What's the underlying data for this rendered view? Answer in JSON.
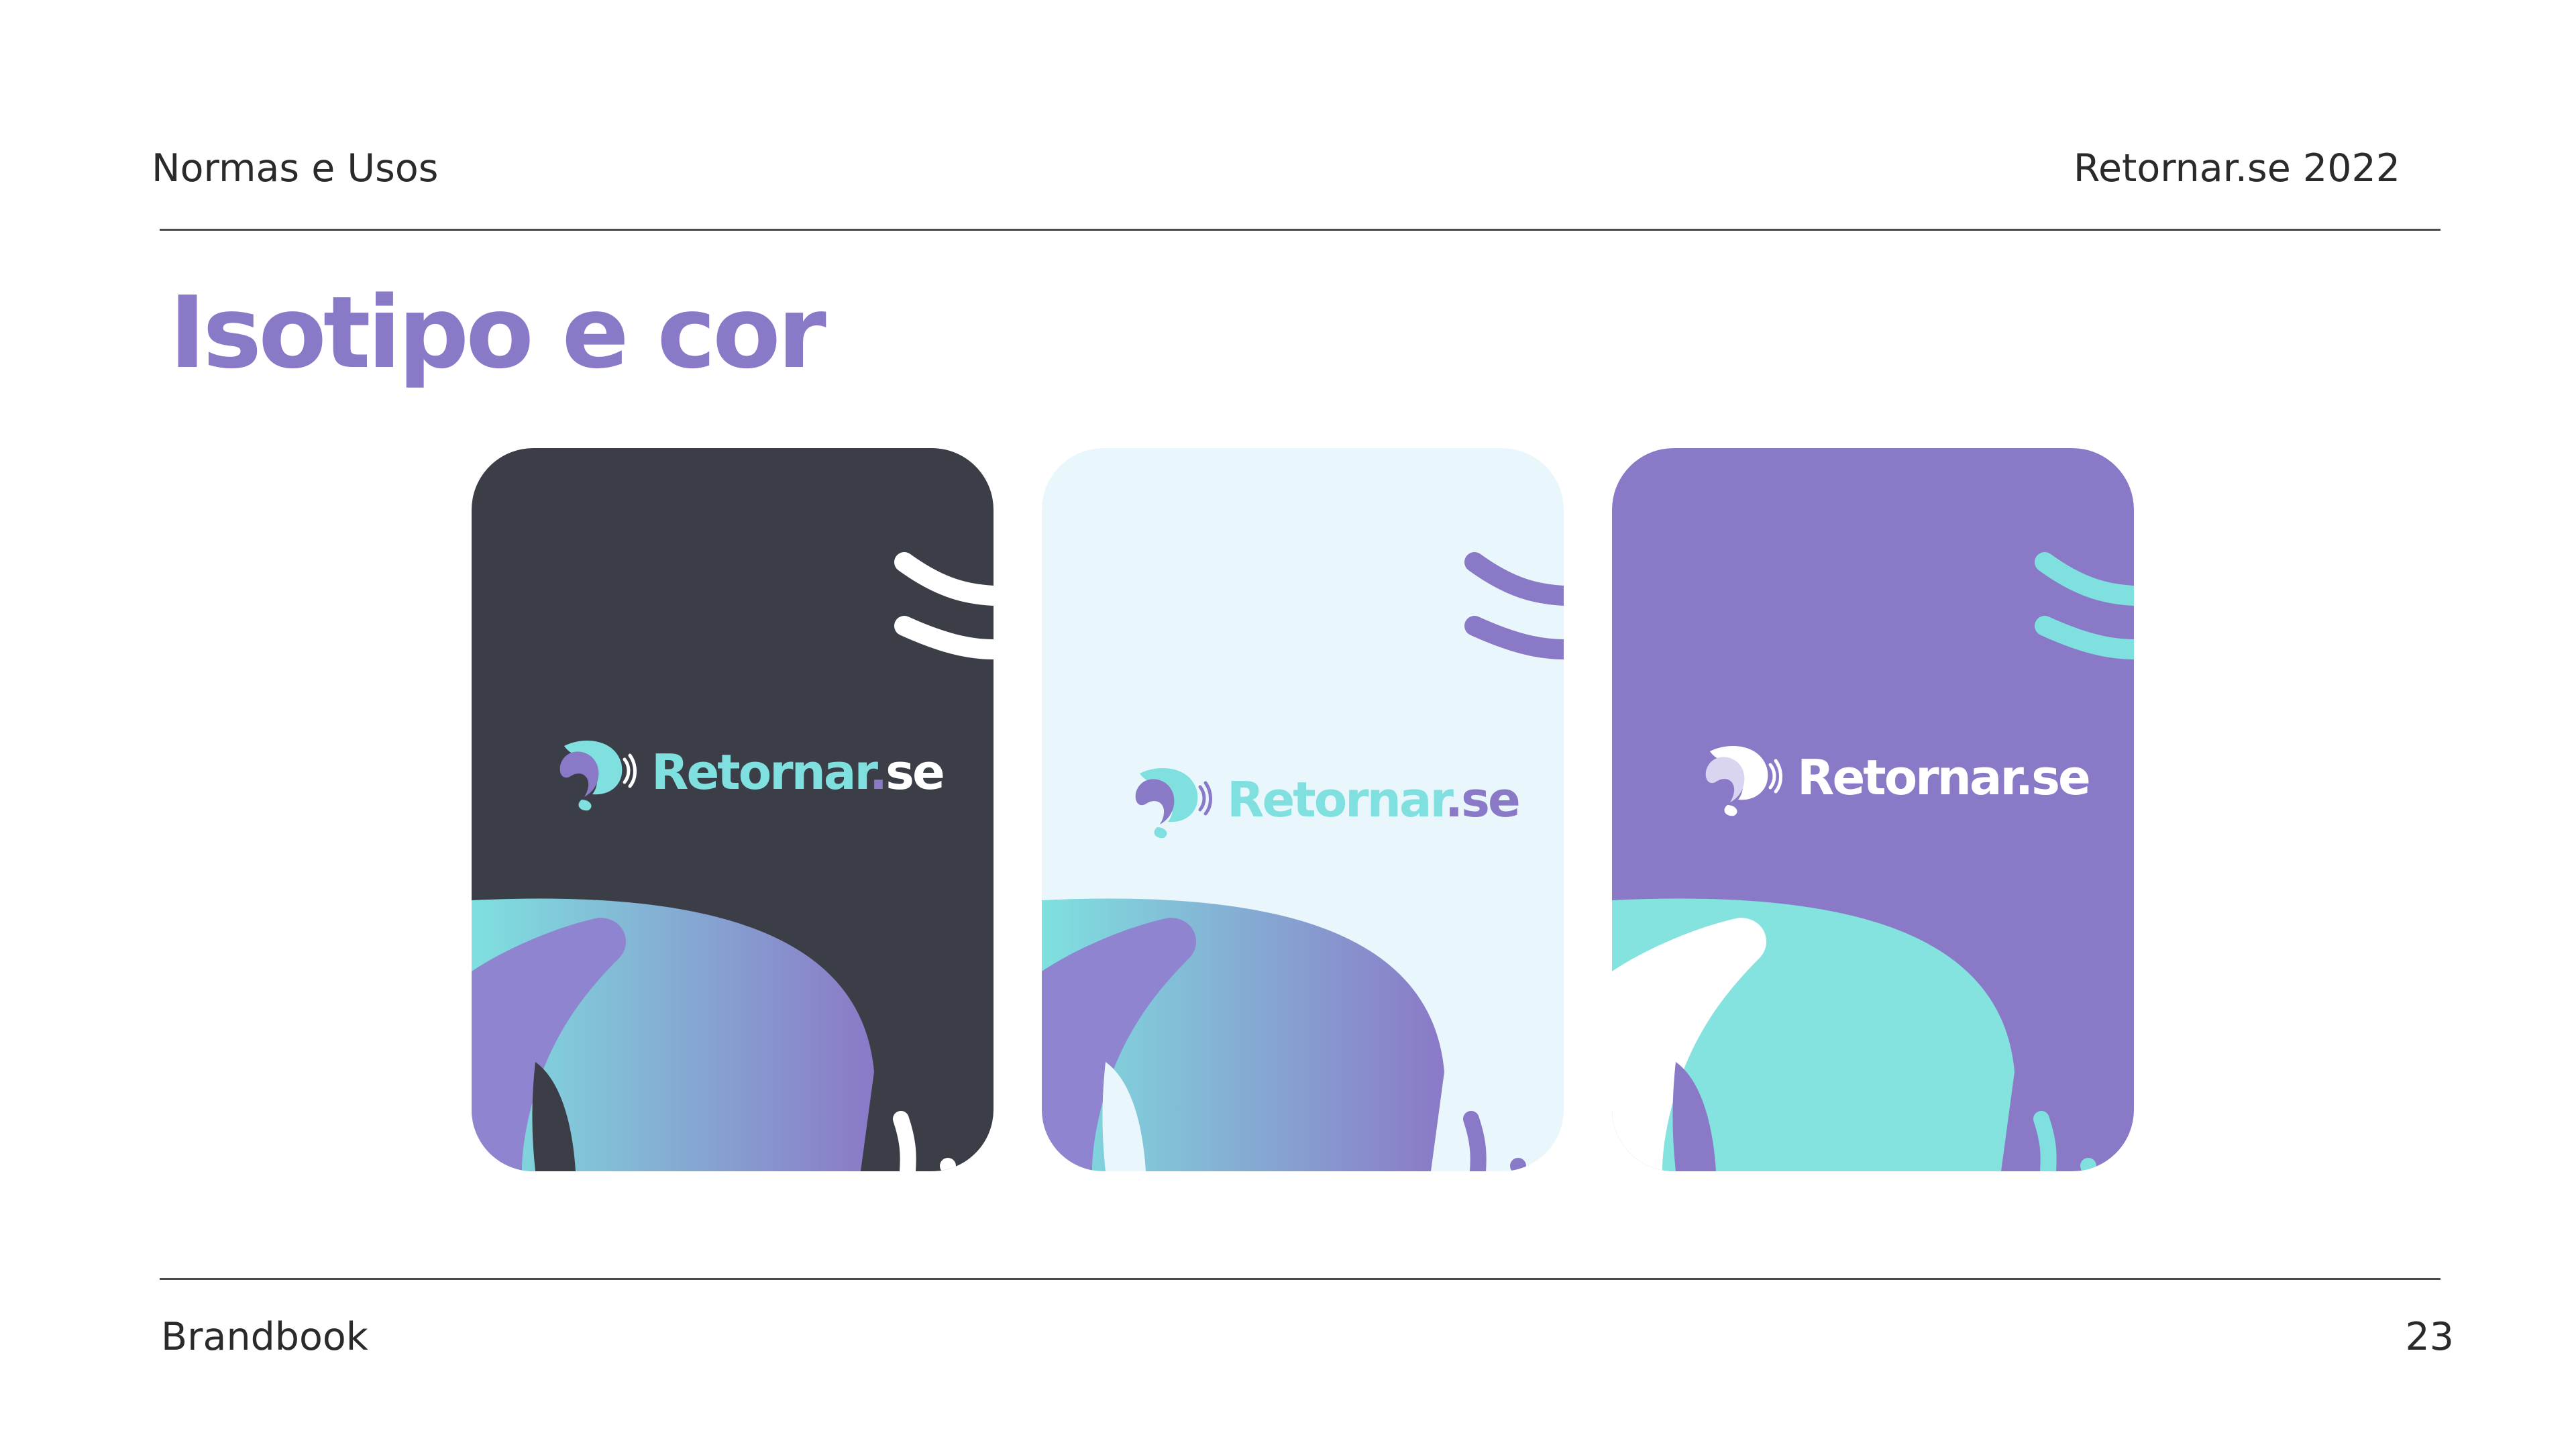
{
  "header": {
    "section": "Normas e Usos",
    "brand_year": "Retornar.se 2022"
  },
  "title": "Isotipo e cor",
  "footer": {
    "label": "Brandbook",
    "page": "23"
  },
  "colors": {
    "purple": "#8a79c7",
    "teal": "#7fe0df",
    "dark": "#3c3e47",
    "light_bg": "#e9f7fc",
    "white": "#ffffff"
  },
  "cards": [
    {
      "variant": "dark",
      "word_main": "Retornar",
      "word_dot": ".",
      "word_suffix": "se"
    },
    {
      "variant": "light",
      "word_main": "Retornar",
      "word_dot": ".",
      "word_suffix": "se"
    },
    {
      "variant": "purple",
      "word_main": "Retornar",
      "word_dot": ".",
      "word_suffix": "se"
    }
  ]
}
